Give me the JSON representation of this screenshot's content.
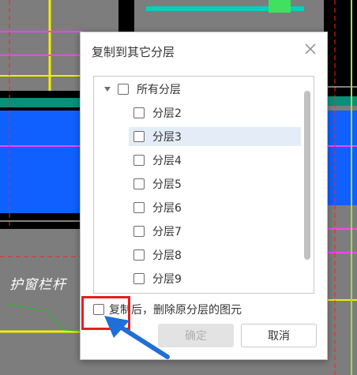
{
  "background": {
    "label": "护窗栏杆"
  },
  "dialog": {
    "title": "复制到其它分层",
    "close_icon": "close-icon",
    "tree": {
      "root_label": "所有分层",
      "expanded": true,
      "items": [
        {
          "label": "分层2",
          "checked": false,
          "selected": false
        },
        {
          "label": "分层3",
          "checked": false,
          "selected": true
        },
        {
          "label": "分层4",
          "checked": false,
          "selected": false
        },
        {
          "label": "分层5",
          "checked": false,
          "selected": false
        },
        {
          "label": "分层6",
          "checked": false,
          "selected": false
        },
        {
          "label": "分层7",
          "checked": false,
          "selected": false
        },
        {
          "label": "分层8",
          "checked": false,
          "selected": false
        },
        {
          "label": "分层9",
          "checked": false,
          "selected": false
        }
      ]
    },
    "delete_option_label": "复制后，删除原分层的图元",
    "delete_option_checked": false,
    "ok_label": "确定",
    "ok_enabled": false,
    "cancel_label": "取消"
  },
  "annotation": {
    "highlight_color": "#e02020",
    "arrow_color": "#1f6fd6"
  }
}
